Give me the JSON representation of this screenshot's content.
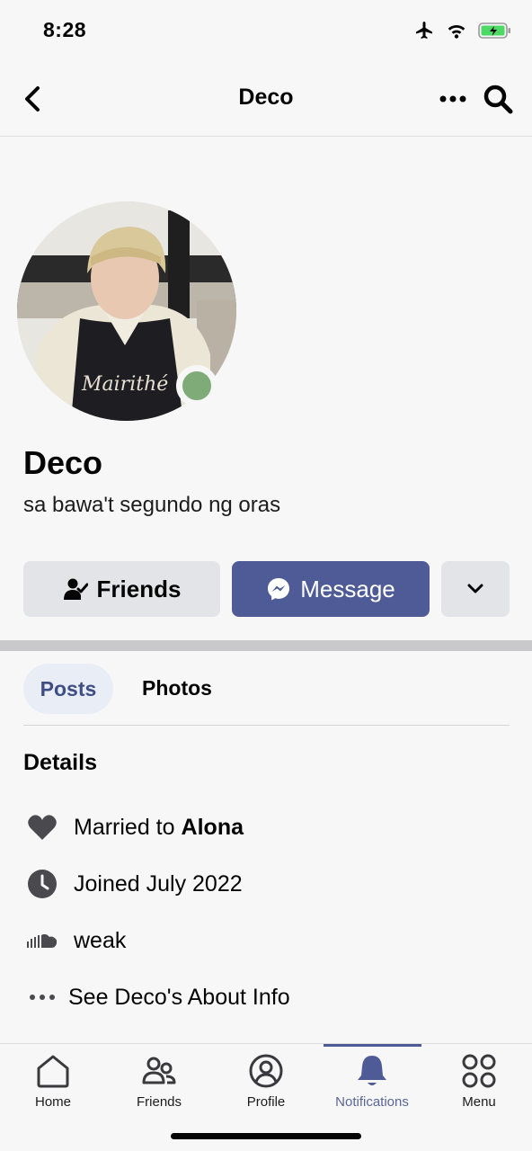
{
  "status": {
    "time": "8:28"
  },
  "header": {
    "title": "Deco"
  },
  "profile": {
    "name": "Deco",
    "bio": "sa bawa't segundo ng oras",
    "online": true,
    "online_color": "#7fab78"
  },
  "actions": {
    "friends_label": "Friends",
    "message_label": "Message"
  },
  "tabs": [
    {
      "label": "Posts",
      "active": true
    },
    {
      "label": "Photos",
      "active": false
    }
  ],
  "details": {
    "title": "Details",
    "married_prefix": "Married to",
    "married_name": "Alona",
    "joined": "Joined July 2022",
    "soundcloud": "weak",
    "see_about": "See Deco's About Info"
  },
  "bottom_nav": [
    {
      "label": "Home",
      "icon": "home-icon"
    },
    {
      "label": "Friends",
      "icon": "friends-icon"
    },
    {
      "label": "Profile",
      "icon": "profile-icon"
    },
    {
      "label": "Notifications",
      "icon": "bell-icon",
      "active": true
    },
    {
      "label": "Menu",
      "icon": "menu-grid-icon"
    }
  ],
  "colors": {
    "accent": "#4f5b96",
    "button_gray": "#e3e4e7",
    "background": "#f7f7f8"
  }
}
